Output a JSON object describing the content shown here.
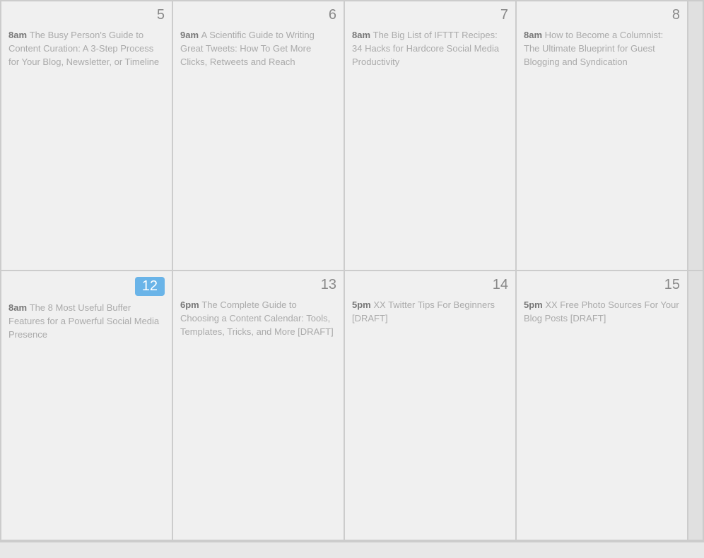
{
  "weeks": [
    {
      "id": "week1",
      "days": [
        {
          "id": "day5",
          "number": "5",
          "active": false,
          "events": [
            {
              "time": "8am",
              "title": "The Busy Person's Guide to Content Curation: A 3-Step Process for Your Blog, Newsletter, or Timeline"
            }
          ]
        },
        {
          "id": "day6",
          "number": "6",
          "active": false,
          "events": [
            {
              "time": "9am",
              "title": "A Scientific Guide to Writing Great Tweets: How To Get More Clicks, Retweets and Reach"
            }
          ]
        },
        {
          "id": "day7",
          "number": "7",
          "active": false,
          "events": [
            {
              "time": "8am",
              "title": "The Big List of IFTTT Recipes: 34 Hacks for Hardcore Social Media Productivity"
            }
          ]
        },
        {
          "id": "day8",
          "number": "8",
          "active": false,
          "events": [
            {
              "time": "8am",
              "title": "How to Become a Columnist: The Ultimate Blueprint for Guest Blogging and Syndication"
            }
          ]
        }
      ]
    },
    {
      "id": "week2",
      "days": [
        {
          "id": "day12",
          "number": "12",
          "active": true,
          "events": [
            {
              "time": "8am",
              "title": "The 8 Most Useful Buffer Features for a Powerful Social Media Presence"
            }
          ]
        },
        {
          "id": "day13",
          "number": "13",
          "active": false,
          "events": [
            {
              "time": "6pm",
              "title": "The Complete Guide to Choosing a Content Calendar: Tools, Templates, Tricks, and More [DRAFT]"
            }
          ]
        },
        {
          "id": "day14",
          "number": "14",
          "active": false,
          "events": [
            {
              "time": "5pm",
              "title": "XX Twitter Tips For Beginners [DRAFT]"
            }
          ]
        },
        {
          "id": "day15",
          "number": "15",
          "active": false,
          "events": [
            {
              "time": "5pm",
              "title": "XX Free Photo Sources For Your Blog Posts [DRAFT]"
            }
          ]
        }
      ]
    }
  ]
}
